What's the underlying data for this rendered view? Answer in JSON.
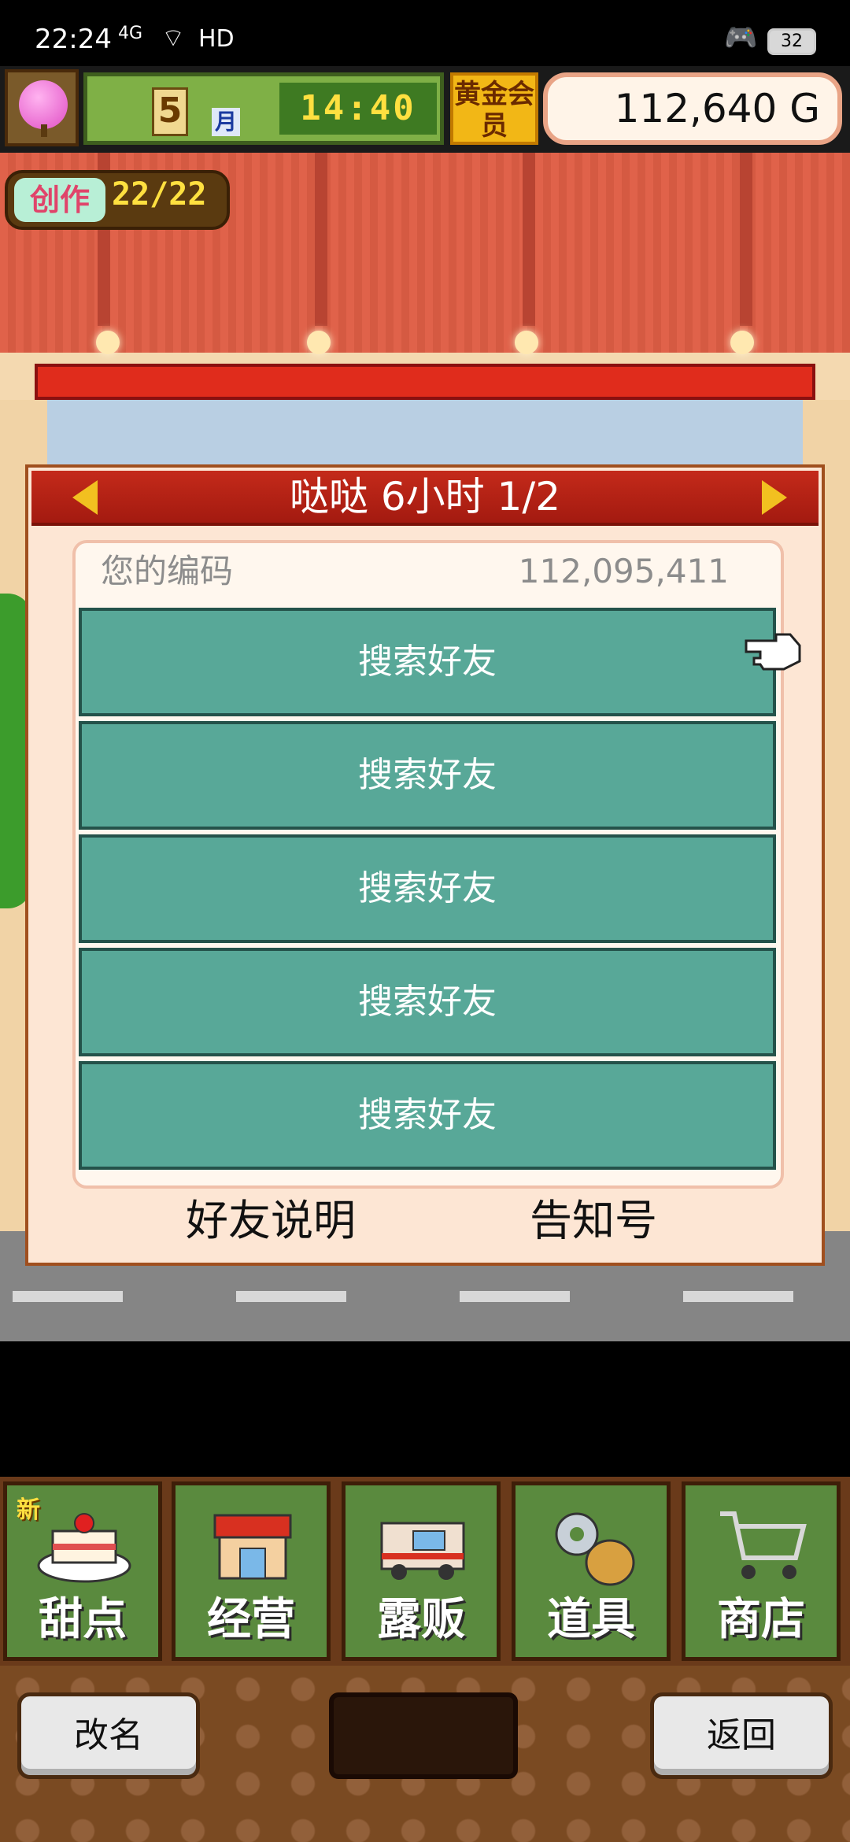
{
  "status_bar": {
    "time": "22:24",
    "network": "4G",
    "hd": "HD",
    "battery": "32"
  },
  "hud": {
    "month_number": "5",
    "month_label": "月",
    "clock": "14:40",
    "gold_member_label": "黄金会员",
    "money": "112,640 G"
  },
  "create_badge": {
    "label": "创作",
    "value": "22/22"
  },
  "dialog": {
    "title": "哒哒  6小时 1/2",
    "code_label": "您的编码",
    "code_value": "112,095,411",
    "friend_slots": [
      "搜索好友",
      "搜索好友",
      "搜索好友",
      "搜索好友",
      "搜索好友"
    ],
    "friend_help": "好友说明",
    "notice_number": "告知号"
  },
  "menu": {
    "new_tag": "新",
    "items": [
      {
        "label": "甜点",
        "icon": "cake-icon"
      },
      {
        "label": "经营",
        "icon": "shop-icon"
      },
      {
        "label": "露贩",
        "icon": "food-truck-icon"
      },
      {
        "label": "道具",
        "icon": "gear-bag-icon"
      },
      {
        "label": "商店",
        "icon": "cart-icon"
      }
    ]
  },
  "bottom_bar": {
    "rename": "改名",
    "back": "返回"
  },
  "colors": {
    "dialog_header": "#c42a1a",
    "friend_button": "#58a898",
    "menu_item": "#5a8a3e",
    "gold_badge": "#f2b716"
  }
}
